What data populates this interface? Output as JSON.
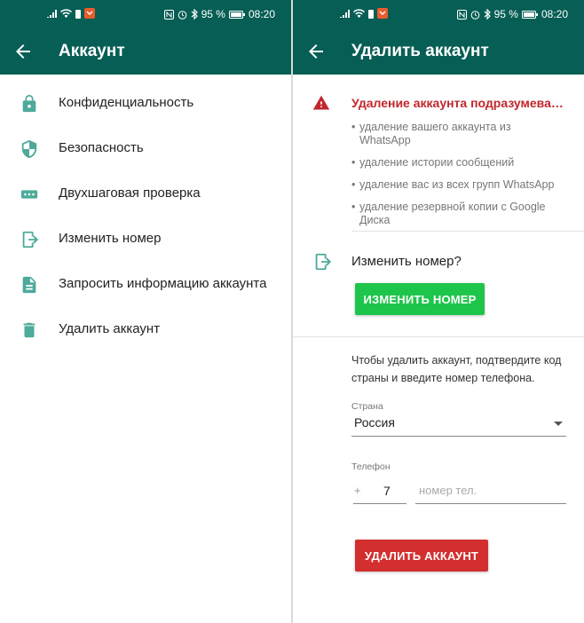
{
  "status_bar": {
    "battery": "95 %",
    "time": "08:20"
  },
  "left_screen": {
    "title": "Аккаунт",
    "items": [
      {
        "label": "Конфиденциальность",
        "icon": "lock-icon"
      },
      {
        "label": "Безопасность",
        "icon": "shield-icon"
      },
      {
        "label": "Двухшаговая проверка",
        "icon": "dots-icon"
      },
      {
        "label": "Изменить номер",
        "icon": "change-number-icon"
      },
      {
        "label": "Запросить информацию аккаунта",
        "icon": "document-icon"
      },
      {
        "label": "Удалить аккаунт",
        "icon": "trash-icon"
      }
    ]
  },
  "right_screen": {
    "title": "Удалить аккаунт",
    "warning_title": "Удаление аккаунта подразумева…",
    "bullets": [
      "удаление вашего аккаунта из WhatsApp",
      "удаление истории сообщений",
      "удаление вас из всех групп WhatsApp",
      "удаление резервной копии с Google Диска"
    ],
    "change_number_question": "Изменить номер?",
    "change_number_button": "ИЗМЕНИТЬ НОМЕР",
    "instructions": "Чтобы удалить аккаунт, подтвердите код страны и введите номер телефона.",
    "country_label": "Страна",
    "country_value": "Россия",
    "phone_label": "Телефон",
    "plus": "+",
    "country_code": "7",
    "phone_placeholder": "номер тел.",
    "delete_button": "УДАЛИТЬ АККАУНТ"
  },
  "colors": {
    "header": "#075e54",
    "icon": "#4eaa9a",
    "warning": "#c0272d",
    "green_button": "#1ec54b",
    "red_button": "#d32f2f"
  }
}
